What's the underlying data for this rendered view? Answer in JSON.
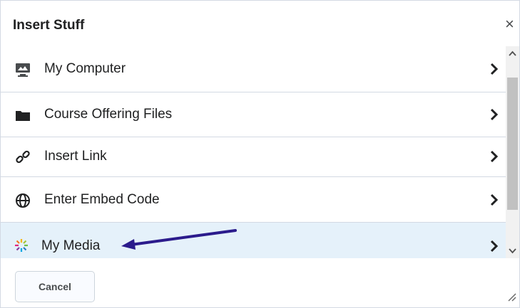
{
  "dialog": {
    "title": "Insert Stuff",
    "close_symbol": "×"
  },
  "items": [
    {
      "label": "My Computer",
      "icon": "monitor-icon"
    },
    {
      "label": "Course Offering Files",
      "icon": "folder-icon"
    },
    {
      "label": "Insert Link",
      "icon": "link-icon"
    },
    {
      "label": "Enter Embed Code",
      "icon": "globe-icon"
    },
    {
      "label": "My Media",
      "icon": "kaltura-media-icon",
      "selected": true
    }
  ],
  "footer": {
    "cancel_label": "Cancel"
  },
  "colors": {
    "selected_row": "#e5f1fa",
    "annotation_arrow": "#2b1b8c"
  }
}
